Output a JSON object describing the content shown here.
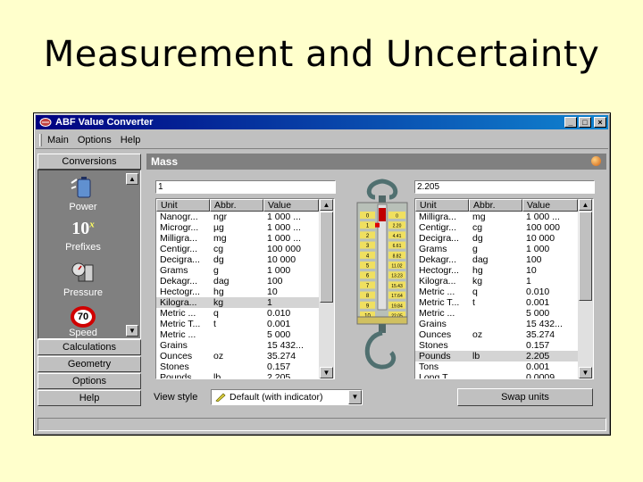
{
  "slide": {
    "title": "Measurement and Uncertainty"
  },
  "window": {
    "title": "ABF Value Converter"
  },
  "menu": [
    "Main",
    "Options",
    "Help"
  ],
  "sidebar": {
    "conversions_label": "Conversions",
    "tools": [
      {
        "label": "Power",
        "icon": "battery-icon"
      },
      {
        "label": "Prefixes",
        "icon": "power-of-ten-icon",
        "glyph": "10",
        "sup": "x"
      },
      {
        "label": "Pressure",
        "icon": "pressure-gauge-icon"
      },
      {
        "label": "Speed",
        "icon": "speed-limit-icon",
        "glyph": "70"
      }
    ],
    "buttons": [
      "Calculations",
      "Geometry",
      "Options",
      "Help"
    ]
  },
  "panel": {
    "title": "Mass"
  },
  "left": {
    "input_value": "1",
    "columns": [
      "Unit",
      "Abbr.",
      "Value"
    ],
    "rows": [
      [
        "Nanogr...",
        "ngr",
        "1 000 ..."
      ],
      [
        "Microgr...",
        "µg",
        "1 000 ..."
      ],
      [
        "Milligra...",
        "mg",
        "1 000 ..."
      ],
      [
        "Centigr...",
        "cg",
        "100 000"
      ],
      [
        "Decigra...",
        "dg",
        "10 000"
      ],
      [
        "Grams",
        "g",
        "1 000"
      ],
      [
        "Dekagr...",
        "dag",
        "100"
      ],
      [
        "Hectogr...",
        "hg",
        "10"
      ],
      [
        "Kilogra...",
        "kg",
        "1"
      ],
      [
        "Metric ...",
        "q",
        "0.010"
      ],
      [
        "Metric T...",
        "t",
        "0.001"
      ],
      [
        "Metric ...",
        "",
        "5 000"
      ],
      [
        "Grains",
        "",
        "15 432..."
      ],
      [
        "Ounces",
        "oz",
        "35.274"
      ],
      [
        "Stones",
        "",
        "0.157"
      ],
      [
        "Pounds",
        "lb",
        "2.205"
      ]
    ],
    "selected": 8
  },
  "right": {
    "input_value": "2.205",
    "columns": [
      "Unit",
      "Abbr.",
      "Value"
    ],
    "rows": [
      [
        "Milligra...",
        "mg",
        "1 000 ..."
      ],
      [
        "Centigr...",
        "cg",
        "100 000"
      ],
      [
        "Decigra...",
        "dg",
        "10 000"
      ],
      [
        "Grams",
        "g",
        "1 000"
      ],
      [
        "Dekagr...",
        "dag",
        "100"
      ],
      [
        "Hectogr...",
        "hg",
        "10"
      ],
      [
        "Kilogra...",
        "kg",
        "1"
      ],
      [
        "Metric ...",
        "q",
        "0.010"
      ],
      [
        "Metric T...",
        "t",
        "0.001"
      ],
      [
        "Metric ...",
        "",
        "5 000"
      ],
      [
        "Grains",
        "",
        "15 432..."
      ],
      [
        "Ounces",
        "oz",
        "35.274"
      ],
      [
        "Stones",
        "",
        "0.157"
      ],
      [
        "Pounds",
        "lb",
        "2.205"
      ],
      [
        "Tons",
        "",
        "0.001"
      ],
      [
        "Long T...",
        "",
        "0.0009..."
      ]
    ],
    "selected": 13
  },
  "scale": {
    "left_ticks": [
      "0",
      "1",
      "2",
      "3",
      "4",
      "5",
      "6",
      "7",
      "8",
      "9",
      "10"
    ],
    "right_ticks": [
      "0",
      "2.20",
      "4.41",
      "6.61",
      "8.82",
      "11.02",
      "13.23",
      "15.43",
      "17.64",
      "19.84",
      "22.05"
    ],
    "indicator_tick": 1
  },
  "footer": {
    "view_style_label": "View style",
    "view_style_value": "Default (with indicator)",
    "swap_label": "Swap units"
  }
}
